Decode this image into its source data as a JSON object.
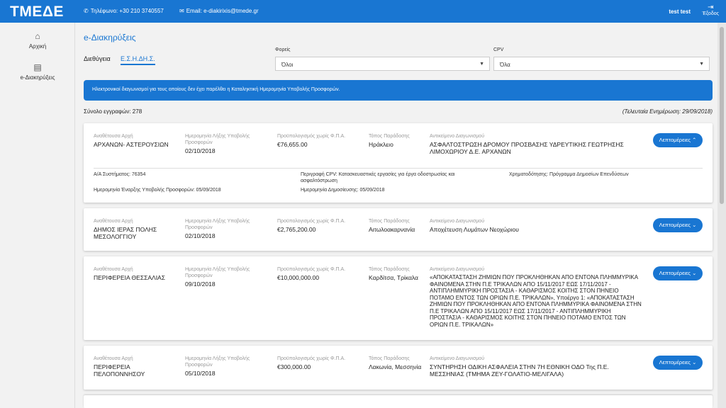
{
  "header": {
    "logo": "ΤΜΕΔΕ",
    "phone": "Τηλέφωνο: +30 210 3740557",
    "email": "Email: e-diakirixis@tmede.gr",
    "user": "test test",
    "logout": "Έξοδος"
  },
  "sidebar": {
    "items": [
      {
        "label": "Αρχική",
        "icon": "home-icon"
      },
      {
        "label": "e-Διακηρύξεις",
        "icon": "document-icon"
      }
    ]
  },
  "page": {
    "title": "e-Διακηρύξεις"
  },
  "tabs": [
    "Διεθύγεια",
    "Ε.Σ.Η.ΔΗ.Σ."
  ],
  "filters": {
    "foreis_label": "Φορείς",
    "foreis_value": "Όλοι",
    "cpv_label": "CPV",
    "cpv_value": "Όλα"
  },
  "banner": "Ηλεκτρονικοί διαγωνισμοί για τους οποίους δεν έχει παρέλθει η Καταληκτική Ημερομηνία Υποβολής Προσφορών.",
  "summary": {
    "count": "Σύνολο εγγραφών: 278",
    "updated": "(Τελευταία Ενημέρωση: 29/09/2018)"
  },
  "labels": {
    "authority": "Αναθέτουσα Αρχή",
    "deadline": "Ημερομηνία Λήξης Υποβολής Προσφορών",
    "budget": "Προϋπολογισμός χωρίς Φ.Π.Α.",
    "place": "Τόπος Παράδοσης",
    "subject": "Αντικείμενο Διαγωνισμού",
    "more": "Λεπτομέρειες ⌃",
    "more_collapsed": "Λεπτομέρειες ⌄"
  },
  "details": {
    "system_no": "Α/Α Συστήματος: 76354",
    "cpv_desc": "Περιγραφή CPV: Κατασκευαστικές εργασίες για έργα οδοστρωσίας και ασφαλτόστρωση",
    "funding": "Χρηματοδότησης: Πρόγραμμα Δημοσίων Επενδύσεων",
    "start": "Ημερομηνία Έναρξης Υποβολής Προσφορών: 05/09/2018",
    "published": "Ημερομηνία Δημοσίευσης: 05/09/2018"
  },
  "cards": [
    {
      "authority": "ΑΡΧΑΝΩΝ- ΑΣΤΕΡΟΥΣΙΩΝ",
      "deadline": "02/10/2018",
      "budget": "€76,655.00",
      "place": "Ηράκλειο",
      "subject": "ΑΣΦΑΛΤΟΣΤΡΩΣΗ ΔΡΟΜΟΥ ΠΡΟΣΒΑΣΗΣ ΥΔΡΕΥΤΙΚΗΣ ΓΕΩΤΡΗΣΗΣ ΛΙΜΟΧΩΡΙΟΥ Δ.Ε. ΑΡΧΑΝΩΝ"
    },
    {
      "authority": "ΔΗΜΟΣ ΙΕΡΑΣ ΠΟΛΗΣ ΜΕΣΟΛΟΓΓΙΟΥ",
      "deadline": "02/10/2018",
      "budget": "€2,765,200.00",
      "place": "Αιτωλοακαρνανία",
      "subject": "Αποχέτευση Λυμάτων Νεοχώριου"
    },
    {
      "authority": "ΠΕΡΙΦΕΡΕΙΑ ΘΕΣΣΑΛΙΑΣ",
      "deadline": "09/10/2018",
      "budget": "€10,000,000.00",
      "place": "Καρδίτσα, Τρίκαλα",
      "subject": "«ΑΠΟΚΑΤΑΣΤΑΣΗ ΖΗΜΙΩΝ ΠΟΥ ΠΡΟΚΛΗΘΗΚΑΝ ΑΠΟ ΕΝΤΟΝΑ ΠΛΗΜΜΥΡΙΚΑ ΦΑΙΝΟΜΕΝΑ ΣΤΗΝ Π.Ε ΤΡΙΚΑΛΩΝ ΑΠΟ 15/11/2017 ΕΩΣ 17/11/2017 - ΑΝΤΙΠΛΗΜΜΥΡΙΚΗ ΠΡΟΣΤΑΣΙΑ - ΚΑΘΑΡΙΣΜΟΣ ΚΟΙΤΗΣ ΣΤΟΝ ΠΗΝΕΙΟ ΠΟΤΑΜΟ ΕΝΤΟΣ ΤΩΝ ΟΡΙΩΝ Π.Ε. ΤΡΙΚΑΛΩΝ», Υποέργο 1: «ΑΠΟΚΑΤΑΣΤΑΣΗ ΖΗΜΙΩΝ ΠΟΥ ΠΡΟΚΛΗΘΗΚΑΝ ΑΠΟ ΕΝΤΟΝΑ ΠΛΗΜΜΥΡΙΚΑ ΦΑΙΝΟΜΕΝΑ ΣΤΗΝ Π.Ε ΤΡΙΚΑΛΩΝ ΑΠΟ 15/11/2017 ΕΩΣ 17/11/2017 - ΑΝΤΙΠΛΗΜΜΥΡΙΚΗ ΠΡΟΣΤΑΣΙΑ - ΚΑΘΑΡΙΣΜΟΣ ΚΟΙΤΗΣ ΣΤΟΝ ΠΗΝΕΙΟ ΠΟΤΑΜΟ ΕΝΤΟΣ ΤΩΝ ΟΡΙΩΝ Π.Ε. ΤΡΙΚΑΛΩΝ»"
    },
    {
      "authority": "ΠΕΡΙΦΕΡΕΙΑ ΠΕΛΟΠΟΝΝΗΣΟΥ",
      "deadline": "05/10/2018",
      "budget": "€300,000.00",
      "place": "Λακωνία, Μεσσηνία",
      "subject": "ΣΥΝΤΗΡΗΣΗ ΟΔΙΚΗ ΑΣΦΑΛΕΙΑ ΣΤΗΝ 7Η ΕΘΝΙΚΗ ΟΔΟ Της Π.Ε. ΜΕΣΣΗΝΙΑΣ (ΤΜΗΜΑ ΖΕΥ-ΓΟΛΑΤΙΟ-ΜΕΛΙΓΑΛΑ)"
    }
  ]
}
